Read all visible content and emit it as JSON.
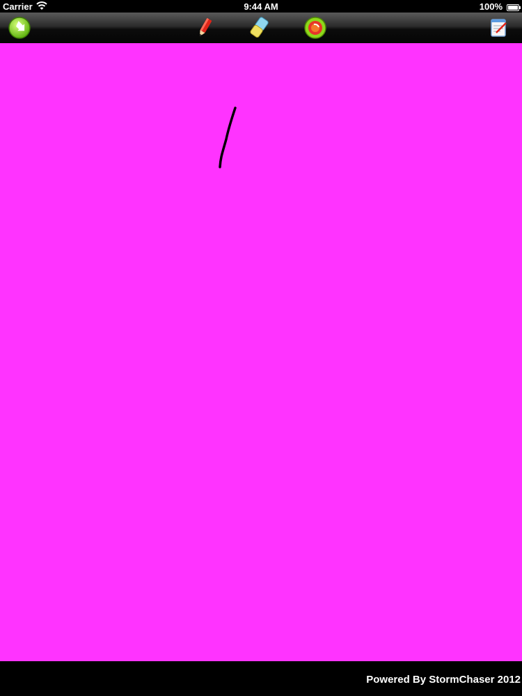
{
  "status_bar": {
    "carrier": "Carrier",
    "time": "9:44 AM",
    "battery": "100%"
  },
  "toolbar": {
    "buttons": [
      {
        "name": "export-button",
        "icon": "export-arrow-icon"
      },
      {
        "name": "pencil-button",
        "icon": "pencil-icon"
      },
      {
        "name": "eraser-button",
        "icon": "eraser-icon"
      },
      {
        "name": "color-button",
        "icon": "color-picker-icon"
      },
      {
        "name": "notes-button",
        "icon": "notepad-icon"
      }
    ]
  },
  "canvas": {
    "background_color": "#ff33ff",
    "stroke_color": "#000000"
  },
  "footer": {
    "credit": "Powered By StormChaser 2012"
  }
}
